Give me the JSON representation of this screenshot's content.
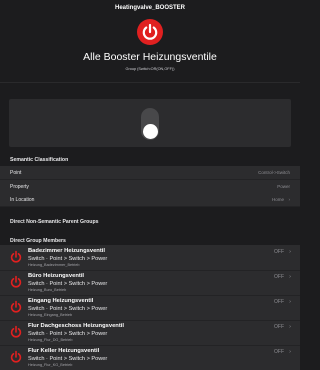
{
  "header": {
    "title": "Heatingvalve_BOOSTER",
    "item_title": "Alle Booster Heizungsventile",
    "item_subtitle": "Group (Switch:OR(ON,OFF))",
    "icon": "power-icon",
    "icon_color": "#e02020"
  },
  "toggle": {
    "state": "OFF"
  },
  "semantic": {
    "header": "Semantic Classification",
    "rows": [
      {
        "label": "Point",
        "value": "Control->Switch"
      },
      {
        "label": "Property",
        "value": "Power"
      },
      {
        "label": "In Location",
        "value": "Home"
      }
    ]
  },
  "parent_groups": {
    "header": "Direct Non-Semantic Parent Groups"
  },
  "members": {
    "header": "Direct Group Members",
    "items": [
      {
        "name": "Badezimmer Heizungsventil",
        "path": "Switch · Point > Switch > Power",
        "item": "Heizung_Badezimmer_Betrieb",
        "state": "OFF"
      },
      {
        "name": "Büro Heizungsventil",
        "path": "Switch · Point > Switch > Power",
        "item": "Heizung_Buro_Betrieb",
        "state": "OFF"
      },
      {
        "name": "Eingang Heizungsventil",
        "path": "Switch · Point > Switch > Power",
        "item": "Heizung_Eingang_Betrieb",
        "state": "OFF"
      },
      {
        "name": "Flur Dachgeschoss Heizungsventil",
        "path": "Switch · Point > Switch > Power",
        "item": "Heizung_Flur_DG_Betrieb",
        "state": "OFF"
      },
      {
        "name": "Flur Keller Heizungsventil",
        "path": "Switch · Point > Switch > Power",
        "item": "Heizung_Flur_KG_Betrieb",
        "state": "OFF"
      }
    ]
  },
  "chevron": "›"
}
